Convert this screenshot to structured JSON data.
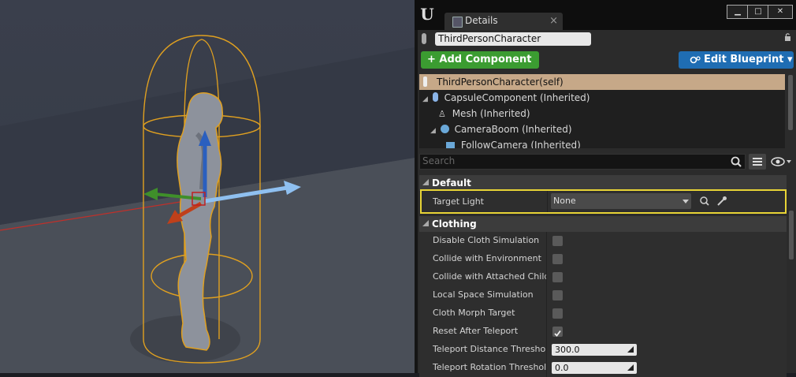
{
  "tab": {
    "title": "Details",
    "close": "×"
  },
  "window": {
    "minimize": "▁",
    "maximize": "□",
    "close": "✕"
  },
  "actor_name": "ThirdPersonCharacter",
  "toolbar": {
    "add_component": "+ Add Component ▾",
    "edit_blueprint": "Edit Blueprint ▾"
  },
  "tree": {
    "items": [
      {
        "label": "ThirdPersonCharacter(self)"
      },
      {
        "label": "CapsuleComponent (Inherited)"
      },
      {
        "label": "Mesh (Inherited)"
      },
      {
        "label": "CameraBoom (Inherited)"
      },
      {
        "label": "FollowCamera (Inherited)"
      }
    ]
  },
  "search": {
    "placeholder": "Search"
  },
  "categories": {
    "default": "Default",
    "clothing": "Clothing"
  },
  "default_props": {
    "target_light": {
      "label": "Target Light",
      "value": "None"
    }
  },
  "clothing_props": [
    {
      "label": "Disable Cloth Simulation",
      "checked": false
    },
    {
      "label": "Collide with Environment",
      "checked": false
    },
    {
      "label": "Collide with Attached Childre",
      "checked": false
    },
    {
      "label": "Local Space Simulation",
      "checked": false
    },
    {
      "label": "Cloth Morph Target",
      "checked": false
    },
    {
      "label": "Reset After Teleport",
      "checked": true
    },
    {
      "label": "Teleport Distance Threshold",
      "value": "300.0"
    },
    {
      "label": "Teleport Rotation Threshold",
      "value": "0.0"
    }
  ],
  "colors": {
    "add_button": "#3b9c31",
    "edit_button": "#1f6db3",
    "selected_row": "#c6a888",
    "highlight": "#e8d436",
    "selection_outline": "#e0a020"
  }
}
